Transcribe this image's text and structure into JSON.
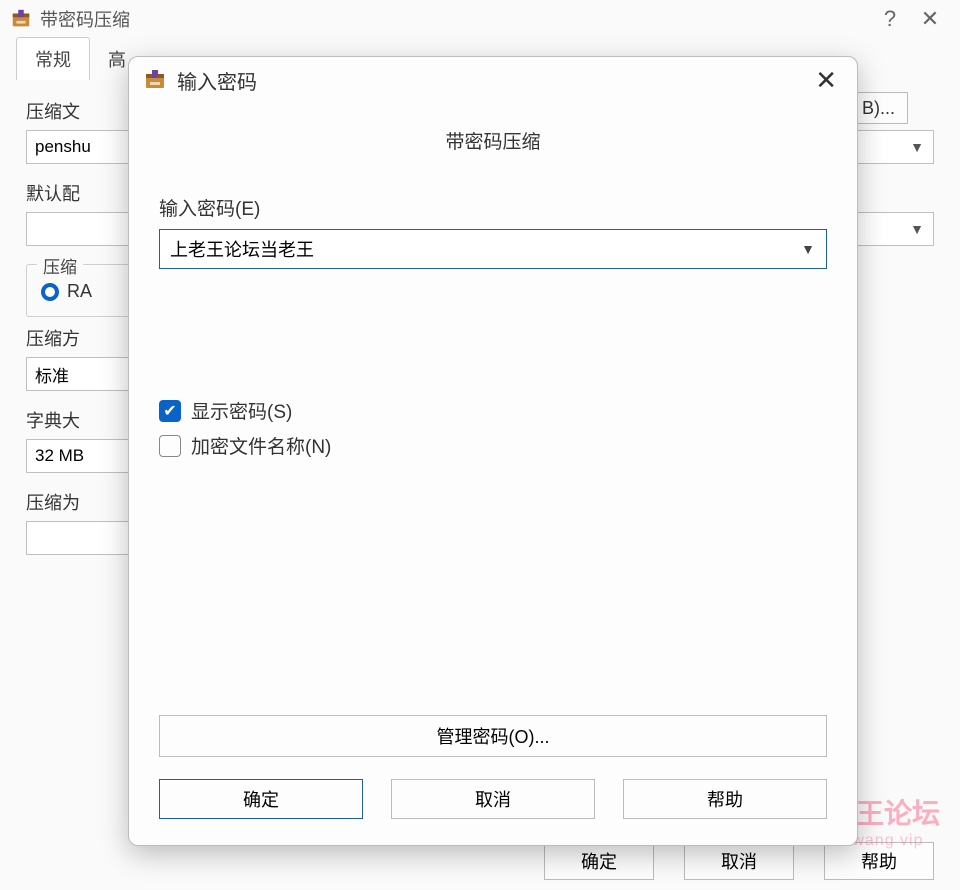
{
  "mainWindow": {
    "title": "带密码压缩",
    "helpGlyph": "?",
    "closeGlyph": "✕",
    "tabs": {
      "active": "常规",
      "nextPartial": "高"
    },
    "labels": {
      "archiveName": "压缩文",
      "archiveValue": "penshu",
      "defaultProfile": "默认配",
      "formatGroup": "压缩",
      "formatRadio": "RA",
      "methodLabel": "压缩方",
      "methodValue": "标准",
      "dictLabel": "字典大",
      "dictValue": "32 MB",
      "splitLabel": "压缩为",
      "browsePartial": "B)..."
    },
    "buttons": {
      "ok": "确定",
      "cancel": "取消",
      "help": "帮助"
    }
  },
  "modal": {
    "title": "输入密码",
    "closeGlyph": "✕",
    "context": "带密码压缩",
    "passwordLabel": "输入密码(E)",
    "passwordValue": "上老王论坛当老王",
    "showPassword": {
      "label": "显示密码(S)",
      "checked": true
    },
    "encryptNames": {
      "label": "加密文件名称(N)",
      "checked": false
    },
    "manageButton": "管理密码(O)...",
    "buttons": {
      "ok": "确定",
      "cancel": "取消",
      "help": "帮助"
    }
  },
  "watermark": {
    "line1": "老王论坛",
    "line2": "laowang vip"
  }
}
